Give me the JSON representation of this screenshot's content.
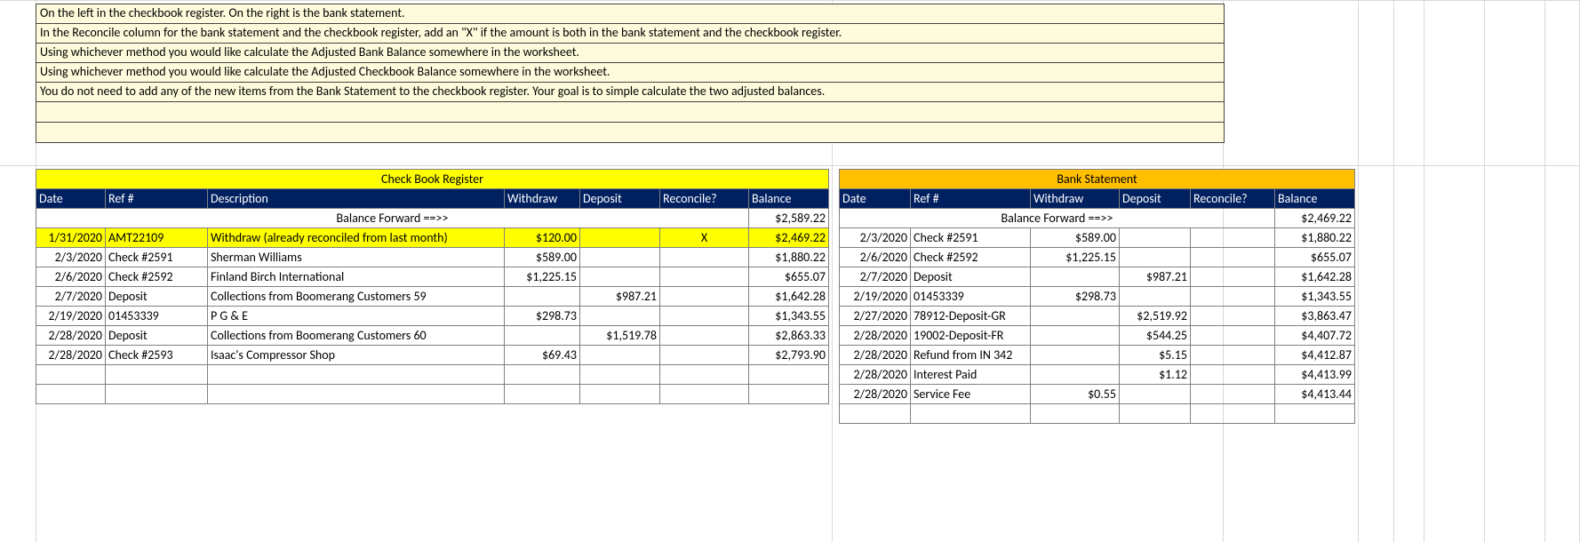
{
  "instructions": [
    "On the left in the checkbook register. On the right is the bank statement.",
    "In the Reconcile column for the bank statement and the checkbook register, add an \"X\" if the amount is both in the bank statement and the checkbook register.",
    "Using whichever method you would like calculate the Adjusted Bank Balance somewhere in the worksheet.",
    "Using whichever method you would like calculate the Adjusted Checkbook Balance somewhere in the worksheet.",
    "You do not need to add any of the new items from the Bank Statement to the checkbook register. Your goal is to simple calculate the two adjusted balances."
  ],
  "checkbook": {
    "title": "Check Book Register",
    "headers": {
      "date": "Date",
      "ref": "Ref #",
      "desc": "Description",
      "withdraw": "Withdraw",
      "deposit": "Deposit",
      "reconcile": "Reconcile?",
      "balance": "Balance"
    },
    "balance_forward_label": "Balance Forward ==>>",
    "balance_forward_value": "$2,589.22",
    "rows": [
      {
        "date": "1/31/2020",
        "ref": "AMT22109",
        "desc": "Withdraw (already reconciled from last month)",
        "withdraw": "$120.00",
        "deposit": "",
        "reconcile": "X",
        "balance": "$2,469.22",
        "highlight": true
      },
      {
        "date": "2/3/2020",
        "ref": "Check #2591",
        "desc": "Sherman Williams",
        "withdraw": "$589.00",
        "deposit": "",
        "reconcile": "",
        "balance": "$1,880.22"
      },
      {
        "date": "2/6/2020",
        "ref": "Check #2592",
        "desc": "Finland Birch International",
        "withdraw": "$1,225.15",
        "deposit": "",
        "reconcile": "",
        "balance": "$655.07"
      },
      {
        "date": "2/7/2020",
        "ref": "Deposit",
        "desc": "Collections from Boomerang Customers 59",
        "withdraw": "",
        "deposit": "$987.21",
        "reconcile": "",
        "balance": "$1,642.28"
      },
      {
        "date": "2/19/2020",
        "ref": "01453339",
        "desc": "P G & E",
        "withdraw": "$298.73",
        "deposit": "",
        "reconcile": "",
        "balance": "$1,343.55"
      },
      {
        "date": "2/28/2020",
        "ref": "Deposit",
        "desc": "Collections from Boomerang Customers 60",
        "withdraw": "",
        "deposit": "$1,519.78",
        "reconcile": "",
        "balance": "$2,863.33"
      },
      {
        "date": "2/28/2020",
        "ref": "Check #2593",
        "desc": "Isaac's Compressor Shop",
        "withdraw": "$69.43",
        "deposit": "",
        "reconcile": "",
        "balance": "$2,793.90"
      }
    ]
  },
  "bank": {
    "title": "Bank Statement",
    "headers": {
      "date": "Date",
      "ref": "Ref #",
      "withdraw": "Withdraw",
      "deposit": "Deposit",
      "reconcile": "Reconcile?",
      "balance": "Balance"
    },
    "balance_forward_label": "Balance Forward ==>>",
    "balance_forward_value": "$2,469.22",
    "rows": [
      {
        "date": "2/3/2020",
        "ref": "Check #2591",
        "withdraw": "$589.00",
        "deposit": "",
        "reconcile": "",
        "balance": "$1,880.22"
      },
      {
        "date": "2/6/2020",
        "ref": "Check #2592",
        "withdraw": "$1,225.15",
        "deposit": "",
        "reconcile": "",
        "balance": "$655.07"
      },
      {
        "date": "2/7/2020",
        "ref": "Deposit",
        "withdraw": "",
        "deposit": "$987.21",
        "reconcile": "",
        "balance": "$1,642.28"
      },
      {
        "date": "2/19/2020",
        "ref": "01453339",
        "withdraw": "$298.73",
        "deposit": "",
        "reconcile": "",
        "balance": "$1,343.55"
      },
      {
        "date": "2/27/2020",
        "ref": "78912-Deposit-GR",
        "withdraw": "",
        "deposit": "$2,519.92",
        "reconcile": "",
        "balance": "$3,863.47"
      },
      {
        "date": "2/28/2020",
        "ref": "19002-Deposit-FR",
        "withdraw": "",
        "deposit": "$544.25",
        "reconcile": "",
        "balance": "$4,407.72"
      },
      {
        "date": "2/28/2020",
        "ref": "Refund from IN 342",
        "withdraw": "",
        "deposit": "$5.15",
        "reconcile": "",
        "balance": "$4,412.87"
      },
      {
        "date": "2/28/2020",
        "ref": "Interest Paid",
        "withdraw": "",
        "deposit": "$1.12",
        "reconcile": "",
        "balance": "$4,413.99"
      },
      {
        "date": "2/28/2020",
        "ref": "Service Fee",
        "withdraw": "$0.55",
        "deposit": "",
        "reconcile": "",
        "balance": "$4,413.44"
      }
    ]
  }
}
